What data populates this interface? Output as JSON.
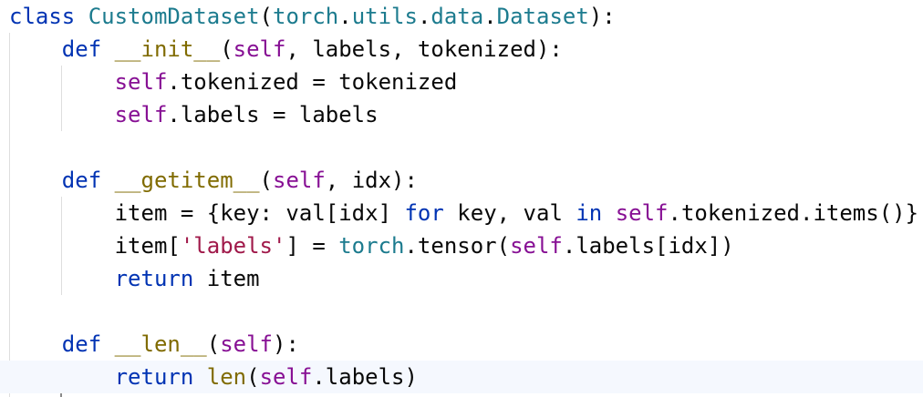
{
  "editor": {
    "language": "python",
    "lines": [
      [
        {
          "t": "class ",
          "c": "tok-class"
        },
        {
          "t": "CustomDataset",
          "c": "tok-teal"
        },
        {
          "t": "(",
          "c": "tok-black"
        },
        {
          "t": "torch",
          "c": "tok-teal"
        },
        {
          "t": ".",
          "c": "tok-black"
        },
        {
          "t": "utils",
          "c": "tok-teal"
        },
        {
          "t": ".",
          "c": "tok-black"
        },
        {
          "t": "data",
          "c": "tok-teal"
        },
        {
          "t": ".",
          "c": "tok-black"
        },
        {
          "t": "Dataset",
          "c": "tok-teal"
        },
        {
          "t": "):",
          "c": "tok-black"
        }
      ],
      [
        {
          "t": "    def ",
          "c": "tok-def"
        },
        {
          "t": "__init__",
          "c": "tok-brown"
        },
        {
          "t": "(",
          "c": "tok-black"
        },
        {
          "t": "self",
          "c": "tok-purple"
        },
        {
          "t": ", labels, tokenized):",
          "c": "tok-black"
        }
      ],
      [
        {
          "t": "        self",
          "c": "tok-purple"
        },
        {
          "t": ".tokenized = tokenized",
          "c": "tok-black"
        }
      ],
      [
        {
          "t": "        self",
          "c": "tok-purple"
        },
        {
          "t": ".labels = labels",
          "c": "tok-black"
        }
      ],
      [],
      [
        {
          "t": "    def ",
          "c": "tok-def"
        },
        {
          "t": "__getitem__",
          "c": "tok-brown"
        },
        {
          "t": "(",
          "c": "tok-black"
        },
        {
          "t": "self",
          "c": "tok-purple"
        },
        {
          "t": ", idx):",
          "c": "tok-black"
        }
      ],
      [
        {
          "t": "        item = {key: val[idx] ",
          "c": "tok-black"
        },
        {
          "t": "for",
          "c": "tok-def"
        },
        {
          "t": " key, val ",
          "c": "tok-black"
        },
        {
          "t": "in",
          "c": "tok-def"
        },
        {
          "t": " ",
          "c": "tok-black"
        },
        {
          "t": "self",
          "c": "tok-purple"
        },
        {
          "t": ".tokenized.items()}",
          "c": "tok-black"
        }
      ],
      [
        {
          "t": "        item[",
          "c": "tok-black"
        },
        {
          "t": "'labels'",
          "c": "tok-str"
        },
        {
          "t": "] = ",
          "c": "tok-black"
        },
        {
          "t": "torch",
          "c": "tok-teal"
        },
        {
          "t": ".tensor(",
          "c": "tok-black"
        },
        {
          "t": "self",
          "c": "tok-purple"
        },
        {
          "t": ".labels[idx])",
          "c": "tok-black"
        }
      ],
      [
        {
          "t": "        return ",
          "c": "tok-def"
        },
        {
          "t": "item",
          "c": "tok-black"
        }
      ],
      [],
      [
        {
          "t": "    def ",
          "c": "tok-def"
        },
        {
          "t": "__len__",
          "c": "tok-brown"
        },
        {
          "t": "(",
          "c": "tok-black"
        },
        {
          "t": "self",
          "c": "tok-purple"
        },
        {
          "t": "):",
          "c": "tok-black"
        }
      ],
      [
        {
          "t": "        return ",
          "c": "tok-def"
        },
        {
          "t": "len",
          "c": "tok-brown"
        },
        {
          "t": "(",
          "c": "tok-black"
        },
        {
          "t": "self",
          "c": "tok-purple"
        },
        {
          "t": ".labels",
          "c": "tok-black"
        },
        {
          "t": ")",
          "c": "tok-black"
        }
      ]
    ],
    "current_line": 11
  }
}
